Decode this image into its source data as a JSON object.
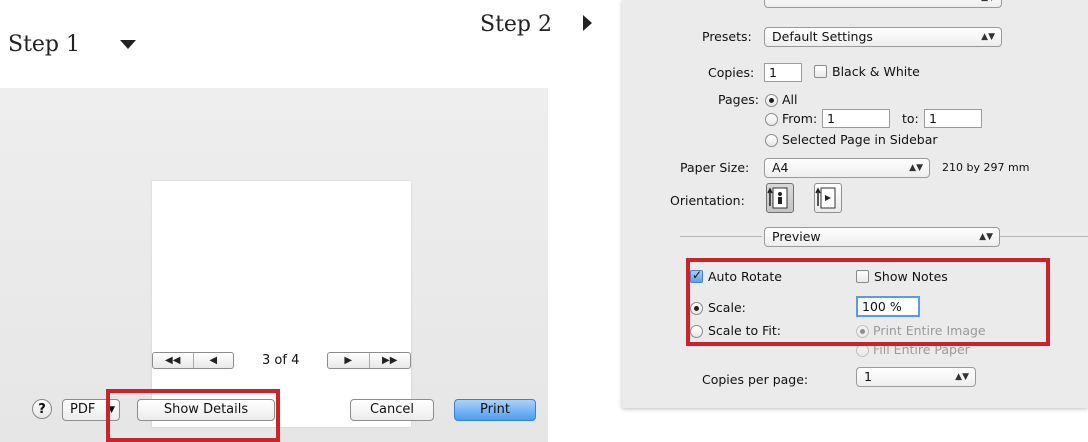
{
  "steps": {
    "step1": "Step 1",
    "step2": "Step 2"
  },
  "dialog_simple": {
    "page_counter": "3 of 4",
    "nav_first": "◀◀",
    "nav_prev": "◀",
    "nav_next": "▶",
    "nav_last": "▶▶",
    "help": "?",
    "pdf": "PDF",
    "show_details": "Show Details",
    "cancel": "Cancel",
    "print": "Print"
  },
  "dialog_details": {
    "presets_label": "Presets:",
    "presets_value": "Default Settings",
    "copies_label": "Copies:",
    "copies_value": "1",
    "bw_label": "Black & White",
    "pages_label": "Pages:",
    "all_label": "All",
    "from_label": "From:",
    "from_value": "1",
    "to_label": "to:",
    "to_value": "1",
    "selected_label": "Selected Page in Sidebar",
    "paper_size_label": "Paper Size:",
    "paper_size_value": "A4",
    "paper_size_dims": "210 by 297 mm",
    "orientation_label": "Orientation:",
    "section_value": "Preview",
    "auto_rotate_label": "Auto Rotate",
    "show_notes_label": "Show Notes",
    "scale_label": "Scale:",
    "scale_value": "100 %",
    "scale_to_fit_label": "Scale to Fit:",
    "print_entire_label": "Print Entire Image",
    "fill_entire_label": "Fill Entire Paper",
    "copies_per_page_label": "Copies per page:",
    "copies_per_page_value": "1"
  },
  "colors": {
    "highlight_red": "#cc2229",
    "print_blue": "#4d9df3"
  }
}
